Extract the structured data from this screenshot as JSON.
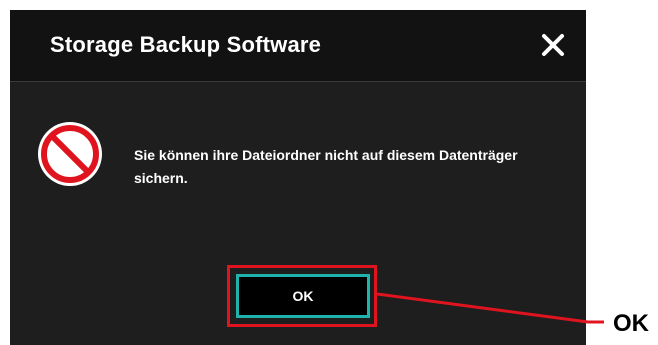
{
  "dialog": {
    "title": "Storage Backup Software",
    "close_icon": "close-icon",
    "status_icon": "prohibited-icon",
    "message": "Sie können ihre Dateiordner nicht auf diesem Datenträger sichern.",
    "ok_label": "OK"
  },
  "annotation": {
    "label": "OK",
    "color": "#e0141e"
  },
  "colors": {
    "dialog_background": "#1e1e1e",
    "titlebar_background": "#121212",
    "focus_border": "#1fb3ae",
    "error_red": "#e0141e"
  }
}
